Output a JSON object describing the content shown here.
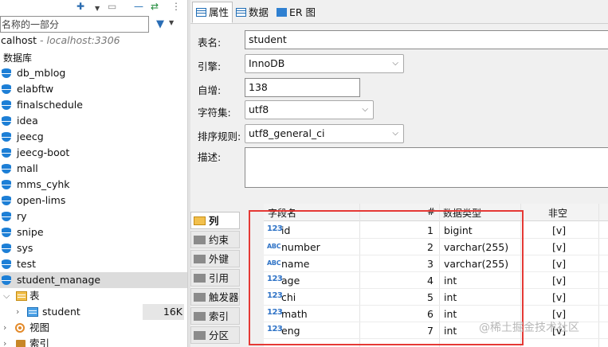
{
  "navigator": {
    "filter_placeholder": "名称的一部分",
    "connection_host": "calhost",
    "connection_local": "- localhost:3306",
    "databases_label": "数据库",
    "databases": [
      "db_mblog",
      "elabftw",
      "finalschedule",
      "idea",
      "jeecg",
      "jeecg-boot",
      "mall",
      "mms_cyhk",
      "open-lims",
      "ry",
      "snipe",
      "sys",
      "test",
      "student_manage"
    ],
    "selected_database": "student_manage",
    "tables_label": "表",
    "table_name": "student",
    "table_size": "16K",
    "views_label": "视图",
    "indexes_label": "索引"
  },
  "editor": {
    "tabs": [
      "属性",
      "数据",
      "ER 图"
    ],
    "active_tab": "属性",
    "labels": {
      "table_name": "表名:",
      "engine": "引擎:",
      "auto_increment": "自增:",
      "charset": "字符集:",
      "collation": "排序规则:",
      "description": "描述:"
    },
    "values": {
      "table_name": "student",
      "engine": "InnoDB",
      "auto_increment": "138",
      "charset": "utf8",
      "collation": "utf8_general_ci"
    },
    "side_tabs": [
      "列",
      "约束",
      "外键",
      "引用",
      "触发器",
      "索引",
      "分区"
    ],
    "active_side_tab": "列",
    "column_headers": [
      "字段名",
      "#",
      "数据类型",
      "非空"
    ],
    "columns": [
      {
        "icon": "123",
        "name": "id",
        "num": "1",
        "type": "bigint",
        "not_null": "[v]"
      },
      {
        "icon": "ABC",
        "name": "number",
        "num": "2",
        "type": "varchar(255)",
        "not_null": "[v]"
      },
      {
        "icon": "ABC",
        "name": "name",
        "num": "3",
        "type": "varchar(255)",
        "not_null": "[v]"
      },
      {
        "icon": "123",
        "name": "age",
        "num": "4",
        "type": "int",
        "not_null": "[v]"
      },
      {
        "icon": "123",
        "name": "chi",
        "num": "5",
        "type": "int",
        "not_null": "[v]"
      },
      {
        "icon": "123",
        "name": "math",
        "num": "6",
        "type": "int",
        "not_null": "[v]"
      },
      {
        "icon": "123",
        "name": "eng",
        "num": "7",
        "type": "int",
        "not_null": "[v]"
      }
    ]
  },
  "watermark": "@稀土掘金技术社区",
  "colors": {
    "highlight": "#e53935",
    "accent": "#1d7fd6"
  }
}
